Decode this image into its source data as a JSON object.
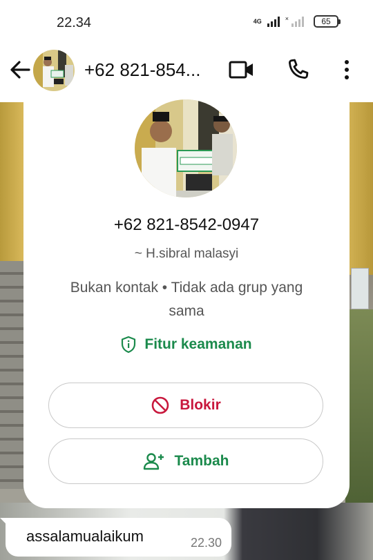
{
  "status_bar": {
    "time": "22.34",
    "network": "4G",
    "sim2": "×",
    "battery": "65"
  },
  "header": {
    "title": "+62 821-854...",
    "avatar": "profile-photo"
  },
  "contact_card": {
    "phone": "+62 821-8542-0947",
    "name": "~ H.sibral malasyi",
    "relation": "Bukan kontak • Tidak ada grup yang sama",
    "security_label": "Fitur keamanan",
    "block_label": "Blokir",
    "add_label": "Tambah"
  },
  "messages": [
    {
      "text": "assalamualaikum",
      "time": "22.30"
    }
  ],
  "colors": {
    "accent_green": "#1b8a4c",
    "block_red": "#c8173c"
  },
  "icons": {
    "back": "arrow-left-icon",
    "video": "video-camera-icon",
    "call": "phone-icon",
    "menu": "more-vertical-icon",
    "security": "shield-icon",
    "block": "block-icon",
    "add": "add-person-icon"
  }
}
